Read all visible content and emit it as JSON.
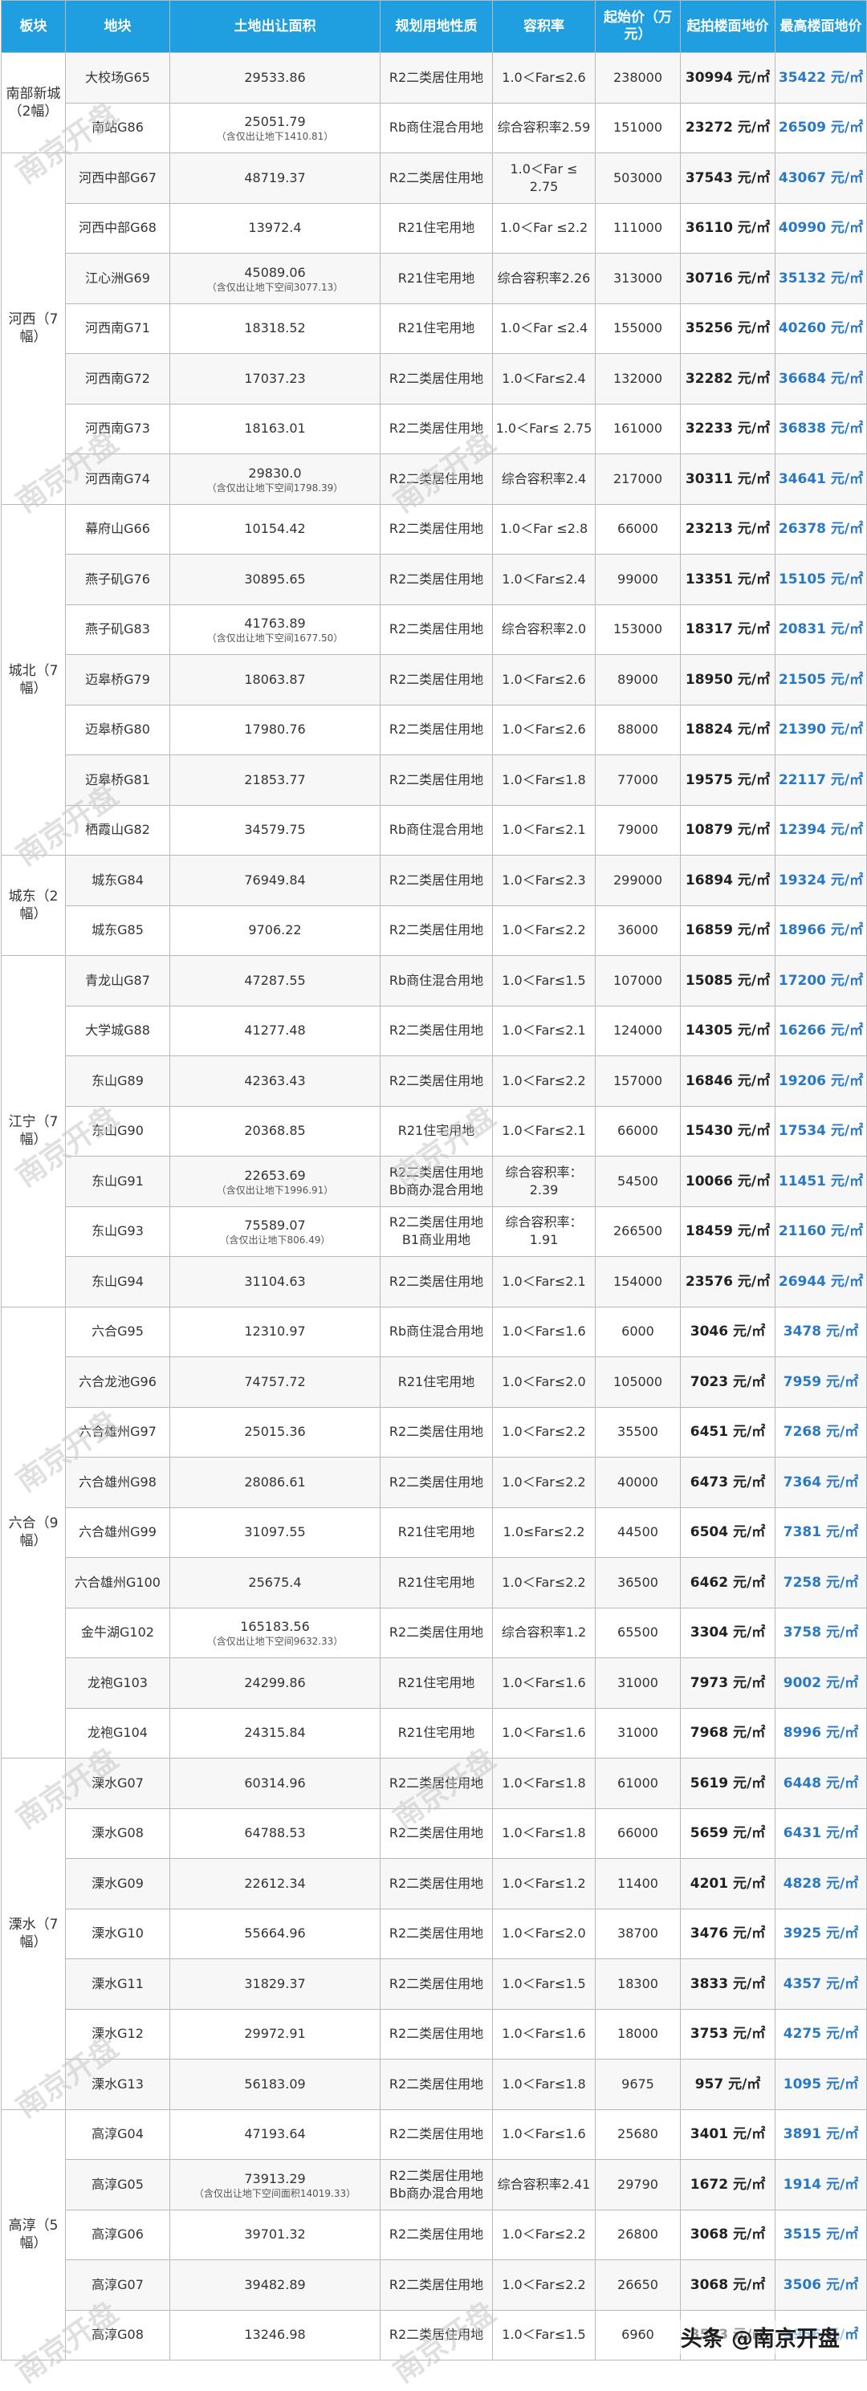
{
  "headers": [
    "板块",
    "地块",
    "土地出让面积",
    "规划用地性质",
    "容积率",
    "起始价（万元）",
    "起拍楼面地价",
    "最高楼面地价"
  ],
  "groups": [
    {
      "region": "南部新城（2幅）",
      "rows": [
        {
          "plot": "大校场G65",
          "area": "29533.86",
          "note": "",
          "use": "R2二类居住用地",
          "far": "1.0＜Far≤2.6",
          "price": "238000",
          "bid": "30994 元/㎡",
          "max": "35422 元/㎡"
        },
        {
          "plot": "南站G86",
          "area": "25051.79",
          "note": "（含仅出让地下1410.81）",
          "use": "Rb商住混合用地",
          "far": "综合容积率2.59",
          "price": "151000",
          "bid": "23272 元/㎡",
          "max": "26509 元/㎡"
        }
      ]
    },
    {
      "region": "河西（7幅）",
      "rows": [
        {
          "plot": "河西中部G67",
          "area": "48719.37",
          "note": "",
          "use": "R2二类居住用地",
          "far": "1.0＜Far ≤ 2.75",
          "price": "503000",
          "bid": "37543 元/㎡",
          "max": "43067 元/㎡"
        },
        {
          "plot": "河西中部G68",
          "area": "13972.4",
          "note": "",
          "use": "R21住宅用地",
          "far": "1.0＜Far ≤2.2",
          "price": "111000",
          "bid": "36110 元/㎡",
          "max": "40990 元/㎡"
        },
        {
          "plot": "江心洲G69",
          "area": "45089.06",
          "note": "（含仅出让地下空间3077.13）",
          "use": "R21住宅用地",
          "far": "综合容积率2.26",
          "price": "313000",
          "bid": "30716 元/㎡",
          "max": "35132 元/㎡"
        },
        {
          "plot": "河西南G71",
          "area": "18318.52",
          "note": "",
          "use": "R21住宅用地",
          "far": "1.0＜Far ≤2.4",
          "price": "155000",
          "bid": "35256 元/㎡",
          "max": "40260 元/㎡"
        },
        {
          "plot": "河西南G72",
          "area": "17037.23",
          "note": "",
          "use": "R2二类居住用地",
          "far": "1.0＜Far≤2.4",
          "price": "132000",
          "bid": "32282 元/㎡",
          "max": "36684 元/㎡"
        },
        {
          "plot": "河西南G73",
          "area": "18163.01",
          "note": "",
          "use": "R2二类居住用地",
          "far": "1.0＜Far≤ 2.75",
          "price": "161000",
          "bid": "32233 元/㎡",
          "max": "36838 元/㎡"
        },
        {
          "plot": "河西南G74",
          "area": "29830.0",
          "note": "（含仅出让地下空间1798.39）",
          "use": "R2二类居住用地",
          "far": "综合容积率2.4",
          "price": "217000",
          "bid": "30311 元/㎡",
          "max": "34641 元/㎡"
        }
      ]
    },
    {
      "region": "城北（7幅）",
      "rows": [
        {
          "plot": "幕府山G66",
          "area": "10154.42",
          "note": "",
          "use": "R2二类居住用地",
          "far": "1.0＜Far ≤2.8",
          "price": "66000",
          "bid": "23213 元/㎡",
          "max": "26378 元/㎡"
        },
        {
          "plot": "燕子矶G76",
          "area": "30895.65",
          "note": "",
          "use": "R2二类居住用地",
          "far": "1.0＜Far≤2.4",
          "price": "99000",
          "bid": "13351 元/㎡",
          "max": "15105 元/㎡"
        },
        {
          "plot": "燕子矶G83",
          "area": "41763.89",
          "note": "（含仅出让地下空间1677.50）",
          "use": "R2二类居住用地",
          "far": "综合容积率2.0",
          "price": "153000",
          "bid": "18317 元/㎡",
          "max": "20831 元/㎡"
        },
        {
          "plot": "迈皋桥G79",
          "area": "18063.87",
          "note": "",
          "use": "R2二类居住用地",
          "far": "1.0＜Far≤2.6",
          "price": "89000",
          "bid": "18950 元/㎡",
          "max": "21505 元/㎡"
        },
        {
          "plot": "迈皋桥G80",
          "area": "17980.76",
          "note": "",
          "use": "R2二类居住用地",
          "far": "1.0＜Far≤2.6",
          "price": "88000",
          "bid": "18824 元/㎡",
          "max": "21390 元/㎡"
        },
        {
          "plot": "迈皋桥G81",
          "area": "21853.77",
          "note": "",
          "use": "R2二类居住用地",
          "far": "1.0＜Far≤1.8",
          "price": "77000",
          "bid": "19575 元/㎡",
          "max": "22117 元/㎡"
        },
        {
          "plot": "栖霞山G82",
          "area": "34579.75",
          "note": "",
          "use": "Rb商住混合用地",
          "far": "1.0＜Far≤2.1",
          "price": "79000",
          "bid": "10879 元/㎡",
          "max": "12394 元/㎡"
        }
      ]
    },
    {
      "region": "城东（2幅）",
      "rows": [
        {
          "plot": "城东G84",
          "area": "76949.84",
          "note": "",
          "use": "R2二类居住用地",
          "far": "1.0＜Far≤2.3",
          "price": "299000",
          "bid": "16894 元/㎡",
          "max": "19324 元/㎡"
        },
        {
          "plot": "城东G85",
          "area": "9706.22",
          "note": "",
          "use": "R2二类居住用地",
          "far": "1.0＜Far≤2.2",
          "price": "36000",
          "bid": "16859 元/㎡",
          "max": "18966 元/㎡"
        }
      ]
    },
    {
      "region": "江宁（7幅）",
      "rows": [
        {
          "plot": "青龙山G87",
          "area": "47287.55",
          "note": "",
          "use": "Rb商住混合用地",
          "far": "1.0＜Far≤1.5",
          "price": "107000",
          "bid": "15085 元/㎡",
          "max": "17200 元/㎡"
        },
        {
          "plot": "大学城G88",
          "area": "41277.48",
          "note": "",
          "use": "R2二类居住用地",
          "far": "1.0＜Far≤2.1",
          "price": "124000",
          "bid": "14305 元/㎡",
          "max": "16266 元/㎡"
        },
        {
          "plot": "东山G89",
          "area": "42363.43",
          "note": "",
          "use": "R2二类居住用地",
          "far": "1.0＜Far≤2.2",
          "price": "157000",
          "bid": "16846 元/㎡",
          "max": "19206 元/㎡"
        },
        {
          "plot": "东山G90",
          "area": "20368.85",
          "note": "",
          "use": "R21住宅用地",
          "far": "1.0＜Far≤2.1",
          "price": "66000",
          "bid": "15430 元/㎡",
          "max": "17534 元/㎡"
        },
        {
          "plot": "东山G91",
          "area": "22653.69",
          "note": "（含仅出让地下1996.91）",
          "use": "R2二类居住用地 Bb商办混合用地",
          "far": "综合容积率：2.39",
          "price": "54500",
          "bid": "10066 元/㎡",
          "max": "11451 元/㎡"
        },
        {
          "plot": "东山G93",
          "area": "75589.07",
          "note": "（含仅出让地下806.49）",
          "use": "R2二类居住用地 B1商业用地",
          "far": "综合容积率：1.91",
          "price": "266500",
          "bid": "18459 元/㎡",
          "max": "21160 元/㎡"
        },
        {
          "plot": "东山G94",
          "area": "31104.63",
          "note": "",
          "use": "R2二类居住用地",
          "far": "1.0＜Far≤2.1",
          "price": "154000",
          "bid": "23576 元/㎡",
          "max": "26944 元/㎡"
        }
      ]
    },
    {
      "region": "六合（9幅）",
      "rows": [
        {
          "plot": "六合G95",
          "area": "12310.97",
          "note": "",
          "use": "Rb商住混合用地",
          "far": "1.0＜Far≤1.6",
          "price": "6000",
          "bid": "3046 元/㎡",
          "max": "3478 元/㎡"
        },
        {
          "plot": "六合龙池G96",
          "area": "74757.72",
          "note": "",
          "use": "R21住宅用地",
          "far": "1.0＜Far≤2.0",
          "price": "105000",
          "bid": "7023 元/㎡",
          "max": "7959 元/㎡"
        },
        {
          "plot": "六合雄州G97",
          "area": "25015.36",
          "note": "",
          "use": "R2二类居住用地",
          "far": "1.0＜Far≤2.2",
          "price": "35500",
          "bid": "6451 元/㎡",
          "max": "7268 元/㎡"
        },
        {
          "plot": "六合雄州G98",
          "area": "28086.61",
          "note": "",
          "use": "R2二类居住用地",
          "far": "1.0＜Far≤2.2",
          "price": "40000",
          "bid": "6473 元/㎡",
          "max": "7364 元/㎡"
        },
        {
          "plot": "六合雄州G99",
          "area": "31097.55",
          "note": "",
          "use": "R21住宅用地",
          "far": "1.0≤Far≤2.2",
          "price": "44500",
          "bid": "6504 元/㎡",
          "max": "7381 元/㎡"
        },
        {
          "plot": "六合雄州G100",
          "area": "25675.4",
          "note": "",
          "use": "R21住宅用地",
          "far": "1.0＜Far≤2.2",
          "price": "36500",
          "bid": "6462 元/㎡",
          "max": "7258 元/㎡"
        },
        {
          "plot": "金牛湖G102",
          "area": "165183.56",
          "note": "（含仅出让地下空间9632.33）",
          "use": "R2二类居住用地",
          "far": "综合容积率1.2",
          "price": "65500",
          "bid": "3304 元/㎡",
          "max": "3758 元/㎡"
        },
        {
          "plot": "龙袍G103",
          "area": "24299.86",
          "note": "",
          "use": "R21住宅用地",
          "far": "1.0＜Far≤1.6",
          "price": "31000",
          "bid": "7973 元/㎡",
          "max": "9002 元/㎡"
        },
        {
          "plot": "龙袍G104",
          "area": "24315.84",
          "note": "",
          "use": "R21住宅用地",
          "far": "1.0＜Far≤1.6",
          "price": "31000",
          "bid": "7968 元/㎡",
          "max": "8996 元/㎡"
        }
      ]
    },
    {
      "region": "溧水（7幅）",
      "rows": [
        {
          "plot": "溧水G07",
          "area": "60314.96",
          "note": "",
          "use": "R2二类居住用地",
          "far": "1.0＜Far≤1.8",
          "price": "61000",
          "bid": "5619 元/㎡",
          "max": "6448 元/㎡"
        },
        {
          "plot": "溧水G08",
          "area": "64788.53",
          "note": "",
          "use": "R2二类居住用地",
          "far": "1.0＜Far≤1.8",
          "price": "66000",
          "bid": "5659 元/㎡",
          "max": "6431 元/㎡"
        },
        {
          "plot": "溧水G09",
          "area": "22612.34",
          "note": "",
          "use": "R2二类居住用地",
          "far": "1.0＜Far≤1.2",
          "price": "11400",
          "bid": "4201 元/㎡",
          "max": "4828 元/㎡"
        },
        {
          "plot": "溧水G10",
          "area": "55664.96",
          "note": "",
          "use": "R2二类居住用地",
          "far": "1.0＜Far≤2.0",
          "price": "38700",
          "bid": "3476 元/㎡",
          "max": "3925 元/㎡"
        },
        {
          "plot": "溧水G11",
          "area": "31829.37",
          "note": "",
          "use": "R2二类居住用地",
          "far": "1.0＜Far≤1.5",
          "price": "18300",
          "bid": "3833 元/㎡",
          "max": "4357 元/㎡"
        },
        {
          "plot": "溧水G12",
          "area": "29972.91",
          "note": "",
          "use": "R2二类居住用地",
          "far": "1.0＜Far≤1.6",
          "price": "18000",
          "bid": "3753 元/㎡",
          "max": "4275 元/㎡"
        },
        {
          "plot": "溧水G13",
          "area": "56183.09",
          "note": "",
          "use": "R2二类居住用地",
          "far": "1.0＜Far≤1.8",
          "price": "9675",
          "bid": "957 元/㎡",
          "max": "1095 元/㎡"
        }
      ]
    },
    {
      "region": "高淳（5幅）",
      "rows": [
        {
          "plot": "高淳G04",
          "area": "47193.64",
          "note": "",
          "use": "R2二类居住用地",
          "far": "1.0＜Far≤1.6",
          "price": "25680",
          "bid": "3401 元/㎡",
          "max": "3891 元/㎡"
        },
        {
          "plot": "高淳G05",
          "area": "73913.29",
          "note": "（含仅出让地下空间面积14019.33）",
          "use": "R2二类居住用地 Bb商办混合用地",
          "far": "综合容积率2.41",
          "price": "29790",
          "bid": "1672 元/㎡",
          "max": "1914 元/㎡"
        },
        {
          "plot": "高淳G06",
          "area": "39701.32",
          "note": "",
          "use": "R2二类居住用地",
          "far": "1.0＜Far≤2.2",
          "price": "26800",
          "bid": "3068 元/㎡",
          "max": "3515 元/㎡"
        },
        {
          "plot": "高淳G07",
          "area": "39482.89",
          "note": "",
          "use": "R2二类居住用地",
          "far": "1.0＜Far≤2.2",
          "price": "26650",
          "bid": "3068 元/㎡",
          "max": "3506 元/㎡"
        },
        {
          "plot": "高淳G08",
          "area": "13246.98",
          "note": "",
          "use": "R2二类居住用地",
          "far": "1.0＜Far≤1.5",
          "price": "6960",
          "bid": "3503 元/㎡",
          "max": "3956 元/㎡"
        }
      ]
    }
  ],
  "watermark": "南京开盘",
  "logo": "头条 @南京开盘"
}
